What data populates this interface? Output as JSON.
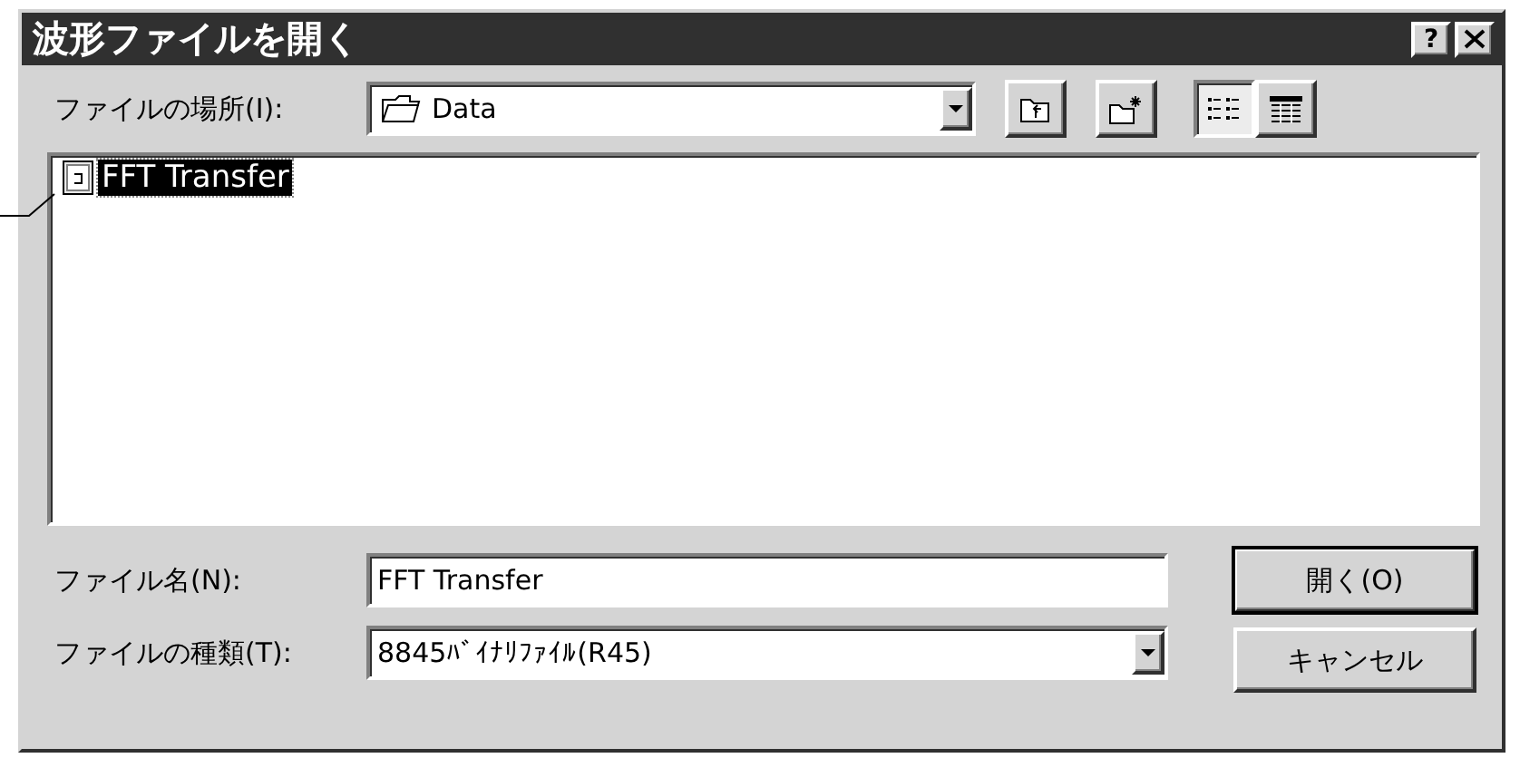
{
  "window": {
    "title": "波形ファイルを開く",
    "help_button": "?"
  },
  "look_in": {
    "label": "ファイルの場所(I):",
    "value": "Data"
  },
  "toolbar": [
    {
      "kind": "up",
      "selected": false
    },
    {
      "kind": "newfolder",
      "selected": false
    },
    {
      "kind": "list",
      "selected": true
    },
    {
      "kind": "details",
      "selected": false
    }
  ],
  "files": [
    {
      "name": "FFT Transfer",
      "selected": true
    }
  ],
  "file_name": {
    "label": "ファイル名(N):",
    "value": "FFT Transfer"
  },
  "file_type": {
    "label": "ファイルの種類(T):",
    "value": "8845ﾊﾞｲﾅﾘﾌｧｲﾙ(R45)"
  },
  "buttons": [
    {
      "label": "開く(O)",
      "default": true
    },
    {
      "label": "キャンセル",
      "default": false
    }
  ]
}
